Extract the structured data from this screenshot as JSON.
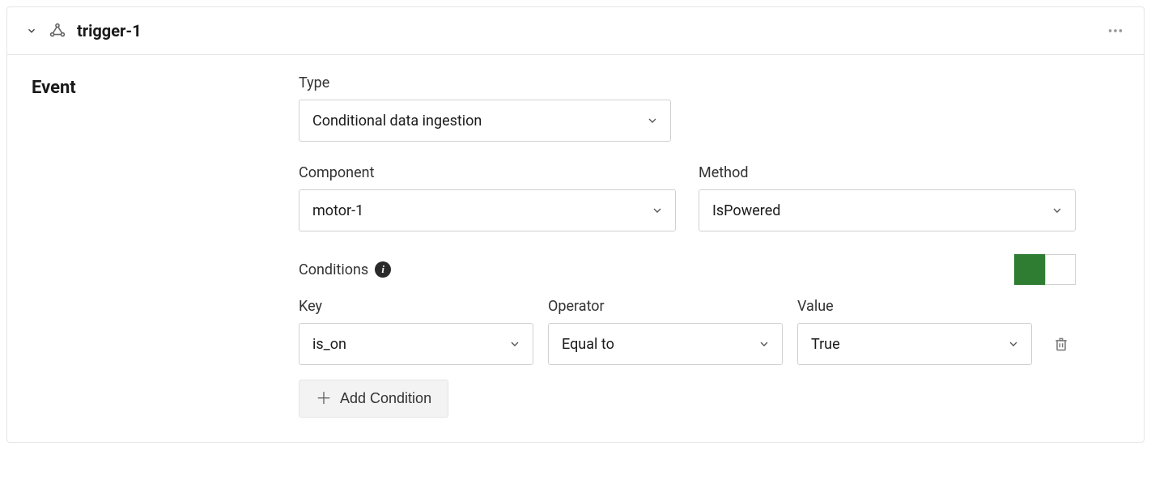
{
  "header": {
    "title": "trigger-1"
  },
  "section": {
    "label": "Event"
  },
  "fields": {
    "type": {
      "label": "Type",
      "value": "Conditional data ingestion"
    },
    "component": {
      "label": "Component",
      "value": "motor-1"
    },
    "method": {
      "label": "Method",
      "value": "IsPowered"
    }
  },
  "conditions": {
    "label": "Conditions",
    "enabled": true,
    "columns": {
      "key": "Key",
      "operator": "Operator",
      "value": "Value"
    },
    "rows": [
      {
        "key": "is_on",
        "operator": "Equal to",
        "value": "True"
      }
    ],
    "add_label": "Add Condition"
  }
}
